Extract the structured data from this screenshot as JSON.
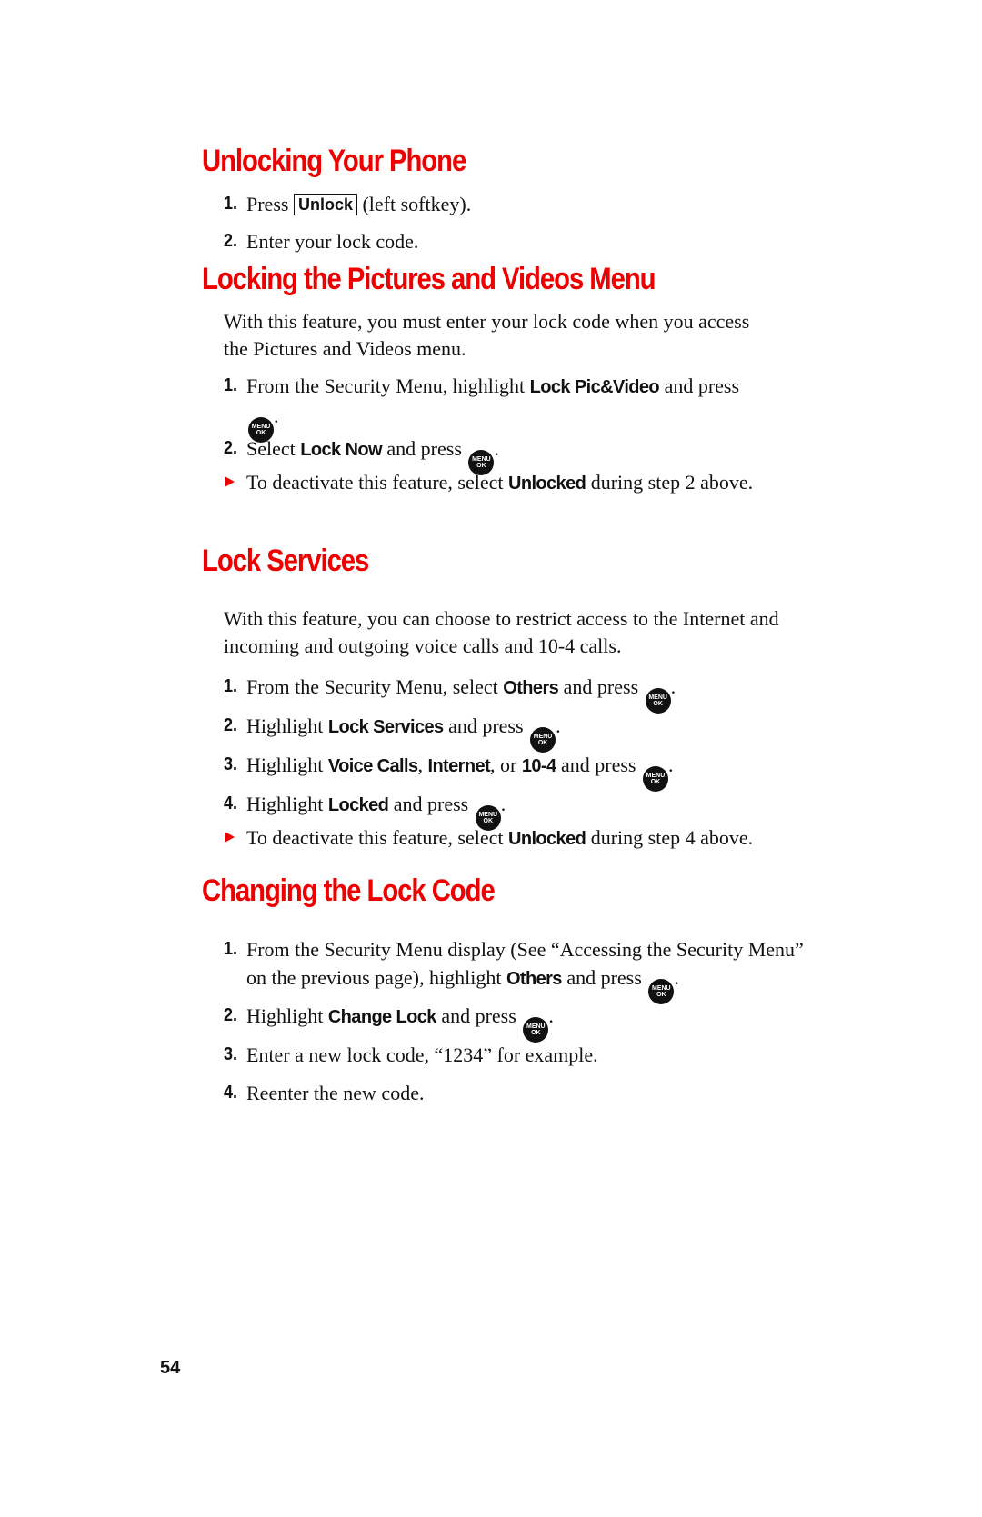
{
  "sections": {
    "unlocking": {
      "title": "Unlocking Your Phone",
      "step1": {
        "num": "1.",
        "pre": "Press ",
        "softkey": "Unlock",
        "post": " (left softkey)."
      },
      "step2": {
        "num": "2.",
        "text": "Enter your lock code."
      }
    },
    "pictures": {
      "title": "Locking the Pictures and Videos Menu",
      "intro": "With this feature, you must enter your lock code when you access the Pictures and Videos menu.",
      "step1": {
        "num": "1.",
        "pre": "From the Security Menu, highlight ",
        "bold": "Lock Pic&Video",
        "mid": " and press",
        "post": "."
      },
      "step2": {
        "num": "2.",
        "pre": "Select ",
        "bold": "Lock Now",
        "mid": " and press",
        "post": "."
      },
      "note": {
        "pre": "To deactivate this feature, select ",
        "bold": "Unlocked",
        "post": " during step 2 above."
      }
    },
    "services": {
      "title": "Lock Services",
      "intro": "With this feature, you can choose to restrict access to the Internet and incoming and outgoing voice calls and 10-4 calls.",
      "step1": {
        "num": "1.",
        "pre": "From the Security Menu, select ",
        "bold": "Others",
        "mid": " and press",
        "post": "."
      },
      "step2": {
        "num": "2.",
        "pre": "Highlight ",
        "bold": "Lock Services",
        "mid": " and press",
        "post": "."
      },
      "step3": {
        "num": "3.",
        "pre": "Highlight ",
        "bold1": "Voice Calls",
        "sep1": ", ",
        "bold2": "Internet",
        "sep2": ", or ",
        "bold3": "10-4",
        "mid": " and press",
        "post": "."
      },
      "step4": {
        "num": "4.",
        "pre": "Highlight ",
        "bold": "Locked",
        "mid": " and press",
        "post": "."
      },
      "note": {
        "pre": "To deactivate this feature, select ",
        "bold": "Unlocked",
        "post": " during step 4 above."
      }
    },
    "changing": {
      "title": "Changing the Lock Code",
      "step1": {
        "num": "1.",
        "pre": "From the Security Menu display (See “Accessing the Security Menu” on the previous page), highlight ",
        "bold": "Others",
        "mid": " and press",
        "post": "."
      },
      "step2": {
        "num": "2.",
        "pre": "Highlight ",
        "bold": "Change Lock",
        "mid": " and press",
        "post": "."
      },
      "step3": {
        "num": "3.",
        "text": "Enter a new lock code, “1234” for example."
      },
      "step4": {
        "num": "4.",
        "text": "Reenter the new code."
      }
    }
  },
  "menu_key": {
    "top": "MENU",
    "bottom": "OK"
  },
  "page_number": "54"
}
